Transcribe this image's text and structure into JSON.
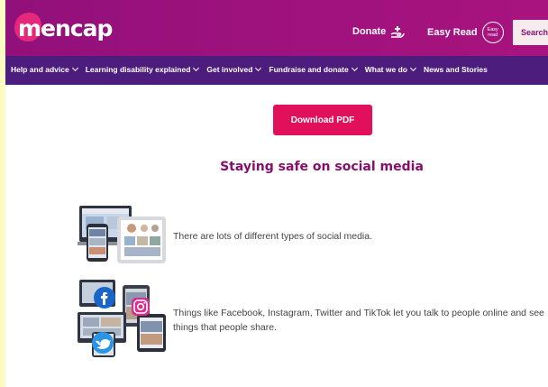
{
  "header": {
    "logo": "mencap",
    "donate_label": "Donate",
    "easyread_label": "Easy Read",
    "easyread_badge_line1": "Easy",
    "easyread_badge_line2": "read",
    "search_label": "Search"
  },
  "nav": {
    "items": [
      {
        "label": "Help and advice"
      },
      {
        "label": "Learning disability explained"
      },
      {
        "label": "Get involved"
      },
      {
        "label": "Fundraise and donate"
      },
      {
        "label": "What we do"
      },
      {
        "label": "News and Stories"
      }
    ]
  },
  "main": {
    "download_label": "Download PDF",
    "title": "Staying safe on social media",
    "items": [
      {
        "text": "There are lots of different types of social media."
      },
      {
        "text": "Things like Facebook, Instagram, Twitter and TikTok let you talk to people online and see things that people share."
      }
    ]
  },
  "colors": {
    "header_bg": "#9c117c",
    "nav_bg": "#4c1d7d",
    "button": "#e20f5a",
    "title": "#860f6e",
    "side_strip": "#fdfbc4"
  },
  "icons": [
    "donate-hand-icon",
    "easy-read-icon",
    "chevron-down-icon",
    "facebook-icon",
    "instagram-icon",
    "twitter-icon"
  ]
}
